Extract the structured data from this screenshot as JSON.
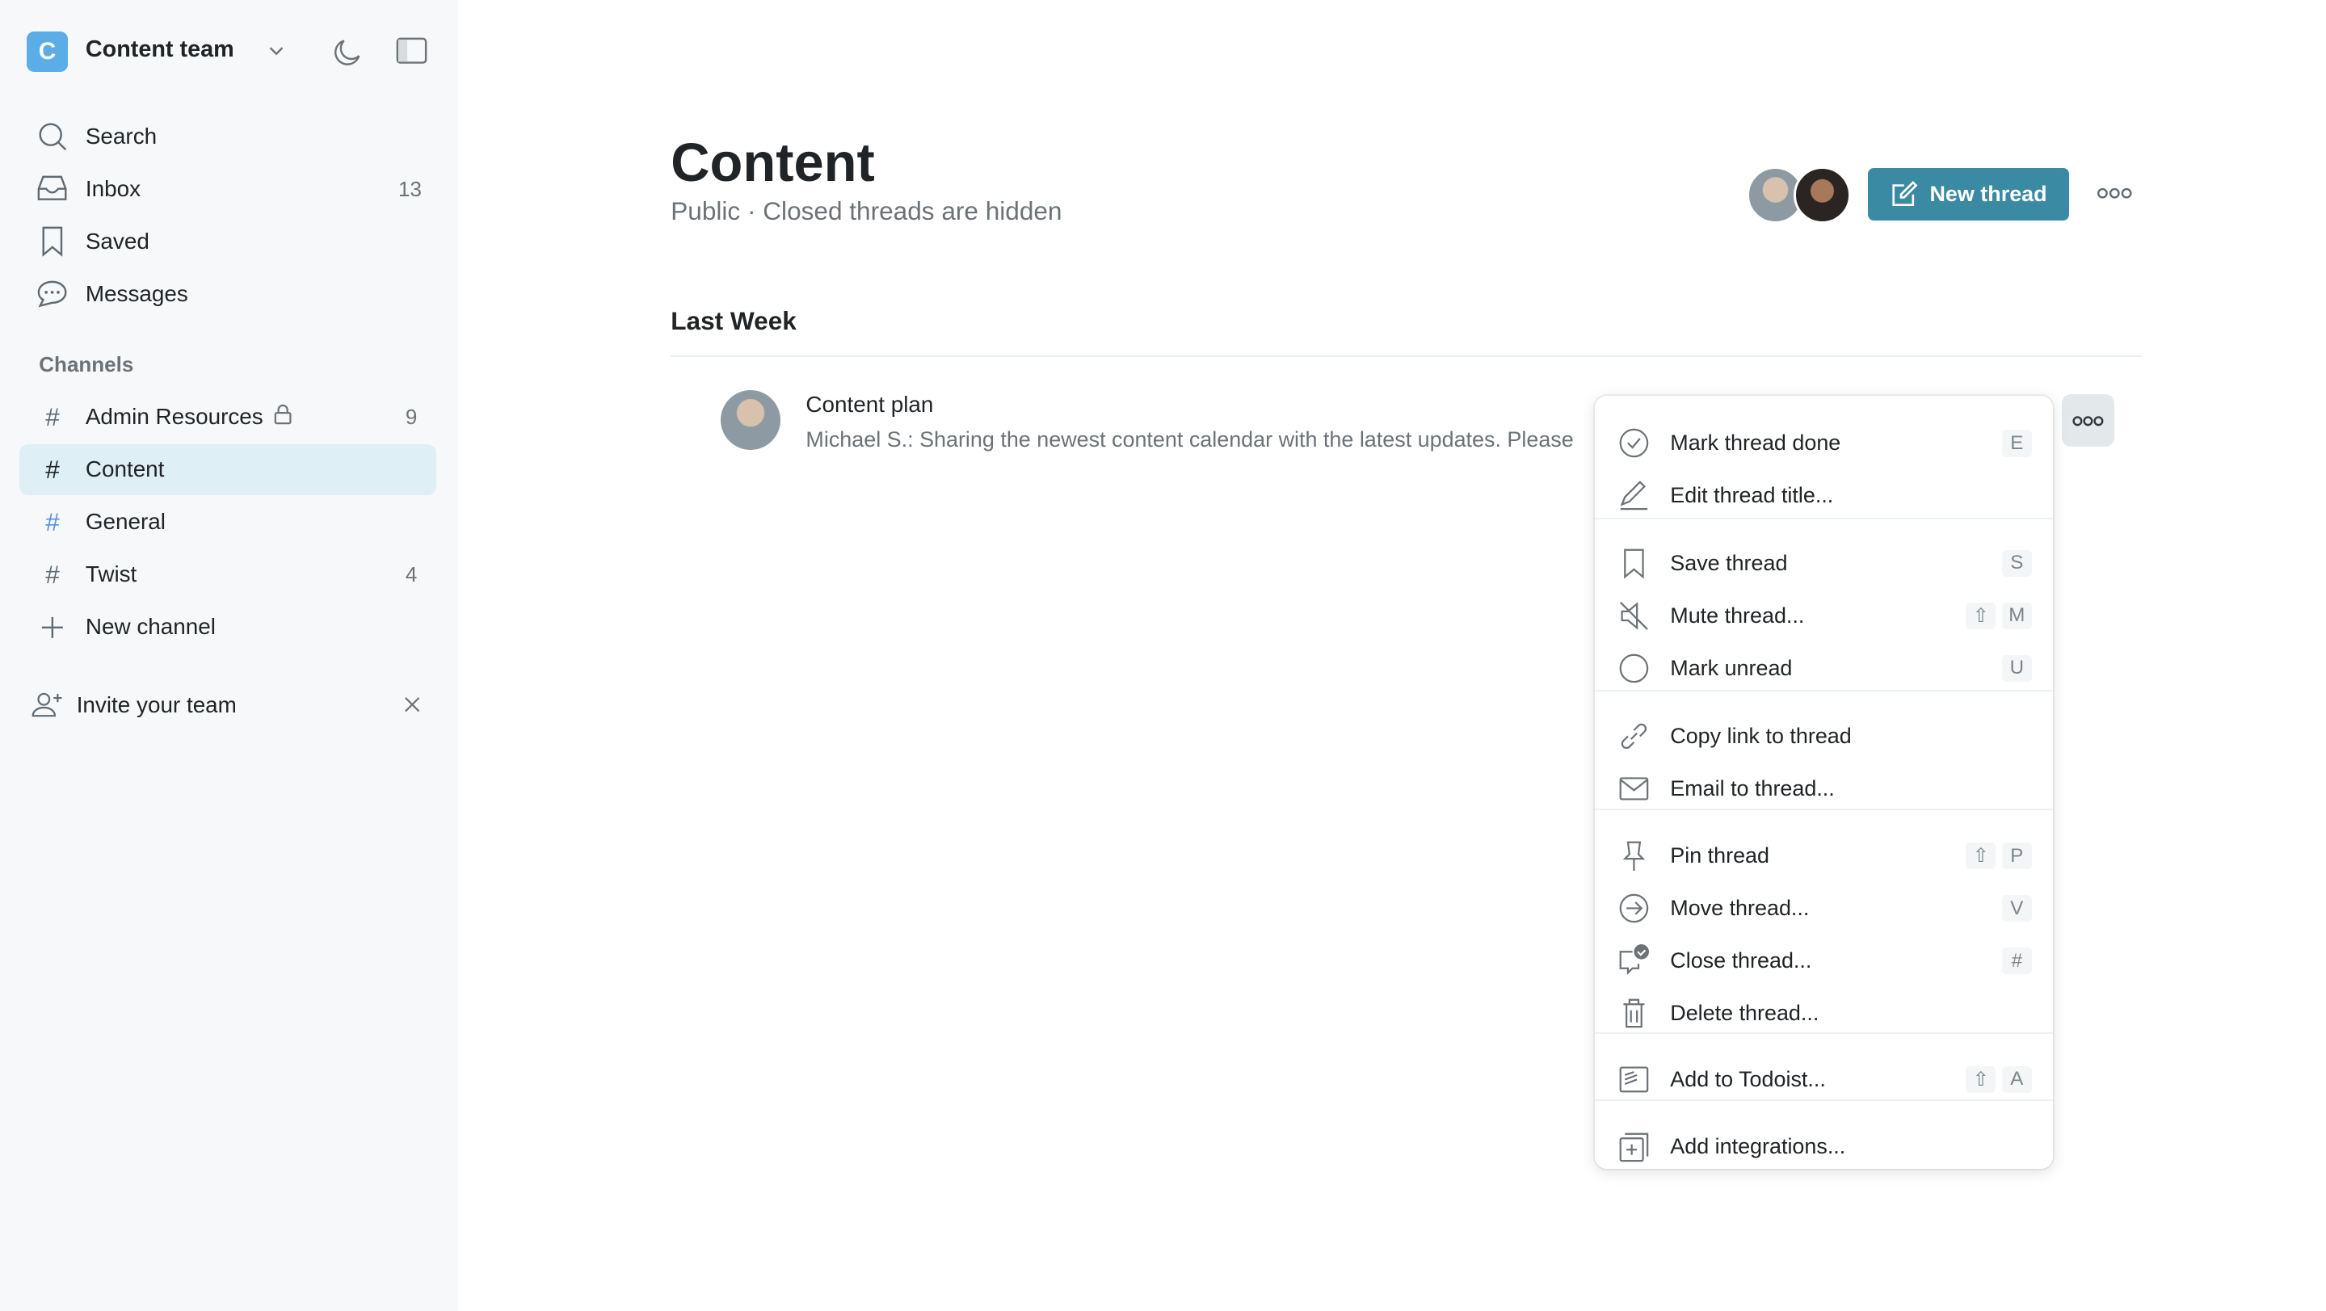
{
  "sidebar": {
    "team_initial": "C",
    "team_name": "Content team",
    "nav": [
      {
        "label": "Search",
        "icon": "search-icon"
      },
      {
        "label": "Inbox",
        "icon": "inbox-icon",
        "count": "13"
      },
      {
        "label": "Saved",
        "icon": "bookmark-icon"
      },
      {
        "label": "Messages",
        "icon": "chat-icon"
      }
    ],
    "channels_label": "Channels",
    "channels": [
      {
        "label": "Admin Resources",
        "count": "9",
        "locked": true
      },
      {
        "label": "Content",
        "active": true
      },
      {
        "label": "General"
      },
      {
        "label": "Twist",
        "count": "4"
      }
    ],
    "new_channel": "New channel",
    "invite": "Invite your team"
  },
  "header": {
    "title": "Content",
    "subtitle": "Public · Closed threads are hidden",
    "new_thread": "New thread"
  },
  "section": "Last Week",
  "thread": {
    "title": "Content plan",
    "preview": "Michael S.: Sharing the newest content calendar with the latest updates. Please"
  },
  "menu": [
    {
      "label": "Mark thread done",
      "icon": "check-circle-icon",
      "keys": [
        "E"
      ]
    },
    {
      "label": "Edit thread title...",
      "icon": "pencil-icon",
      "keys": []
    },
    {
      "label": "Save thread",
      "icon": "bookmark-icon",
      "keys": [
        "S"
      ]
    },
    {
      "label": "Mute thread...",
      "icon": "mute-icon",
      "keys": [
        "⇧",
        "M"
      ]
    },
    {
      "label": "Mark unread",
      "icon": "circle-icon",
      "keys": [
        "U"
      ]
    },
    {
      "label": "Copy link to thread",
      "icon": "link-icon",
      "keys": []
    },
    {
      "label": "Email to thread...",
      "icon": "mail-icon",
      "keys": []
    },
    {
      "label": "Pin thread",
      "icon": "pin-icon",
      "keys": [
        "⇧",
        "P"
      ]
    },
    {
      "label": "Move thread...",
      "icon": "arrow-circle-icon",
      "keys": [
        "V"
      ]
    },
    {
      "label": "Close thread...",
      "icon": "close-thread-icon",
      "keys": [
        "#"
      ]
    },
    {
      "label": "Delete thread...",
      "icon": "trash-icon",
      "keys": []
    },
    {
      "label": "Add to Todoist...",
      "icon": "todoist-icon",
      "keys": [
        "⇧",
        "A"
      ]
    },
    {
      "label": "Add integrations...",
      "icon": "add-integration-icon",
      "keys": []
    }
  ],
  "colors": {
    "accent": "#3b8aa3",
    "team": "#5bade8",
    "active_bg": "#deeff6",
    "sidebar_bg": "#f7f8fa"
  }
}
